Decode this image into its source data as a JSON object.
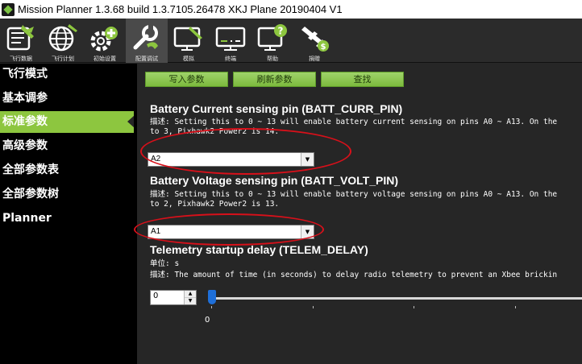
{
  "window": {
    "title": "Mission Planner 1.3.68 build 1.3.7105.26478 XKJ Plane 20190404 V1"
  },
  "toolbar": {
    "items": [
      {
        "label": "飞行数据",
        "icon": "flight-data-icon"
      },
      {
        "label": "飞行计划",
        "icon": "globe-plan-icon"
      },
      {
        "label": "初始设置",
        "icon": "initial-setup-icon"
      },
      {
        "label": "配置调试",
        "icon": "config-tuning-icon"
      },
      {
        "label": "模拟",
        "icon": "simulation-icon"
      },
      {
        "label": "终端",
        "icon": "terminal-icon"
      },
      {
        "label": "帮助",
        "icon": "help-icon"
      },
      {
        "label": "捐赠",
        "icon": "donate-icon"
      }
    ],
    "active_index": 3
  },
  "sidebar": {
    "items": [
      {
        "label": "飞行模式"
      },
      {
        "label": "基本调参"
      },
      {
        "label": "标准参数"
      },
      {
        "label": "高级参数"
      },
      {
        "label": "全部参数表"
      },
      {
        "label": "全部参数树"
      },
      {
        "label": "Planner"
      }
    ],
    "selected_index": 2
  },
  "actions": {
    "write_label": "写入参数",
    "refresh_label": "刷新参数",
    "find_label": "查找"
  },
  "params": {
    "batt_curr": {
      "title": "Battery Current sensing pin (BATT_CURR_PIN)",
      "desc_line1": "描述: Setting this to 0 ~ 13 will enable battery current sensing on pins A0 ~ A13. On the",
      "desc_line2": "to 3, Pixhawk2 Power2 is 14.",
      "value": "A2"
    },
    "batt_volt": {
      "title": "Battery Voltage sensing pin (BATT_VOLT_PIN)",
      "desc_line1": "描述: Setting this to 0 ~ 13 will enable battery voltage sensing on pins A0 ~ A13. On the",
      "desc_line2": "to 2, Pixhawk2 Power2 is 13.",
      "value": "A1"
    },
    "telem_delay": {
      "title": "Telemetry startup delay (TELEM_DELAY)",
      "units": "单位: s",
      "desc": "描述: The amount of time (in seconds) to delay radio telemetry to prevent an Xbee brickin",
      "value": "0",
      "slider_min_label": "0",
      "slider_value": 0
    }
  },
  "colors": {
    "accent_green": "#8dc63f",
    "annotation_red": "#d8101a",
    "slider_thumb": "#1e6fd9"
  }
}
